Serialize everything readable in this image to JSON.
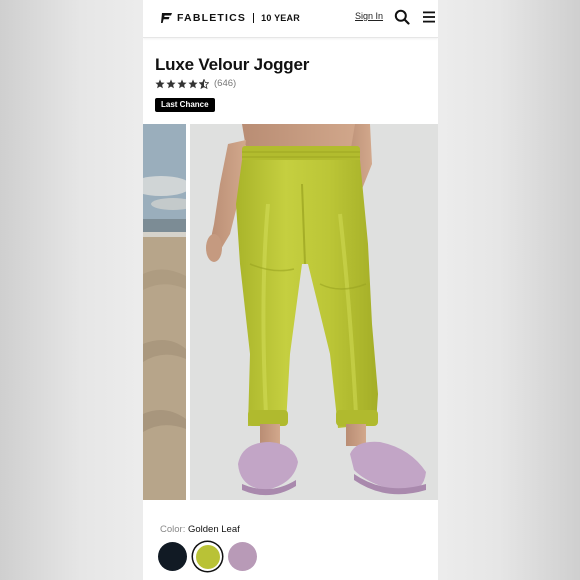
{
  "header": {
    "brand": "FABLETICS",
    "year_label": "10 YEAR",
    "signin_label": "Sign In"
  },
  "product": {
    "title": "Luxe Velour Jogger",
    "rating": 4.5,
    "review_count": "(646)",
    "badge": "Last Chance"
  },
  "color": {
    "label": "Color:",
    "selected": "Golden Leaf",
    "swatches": [
      {
        "name": "black",
        "hex": "#111a24"
      },
      {
        "name": "Golden Leaf",
        "hex": "#b9c236"
      },
      {
        "name": "lavender",
        "hex": "#b89ab7"
      }
    ]
  },
  "icons": [
    "fabletics-logo-icon",
    "search-icon",
    "menu-icon",
    "star-icon"
  ]
}
